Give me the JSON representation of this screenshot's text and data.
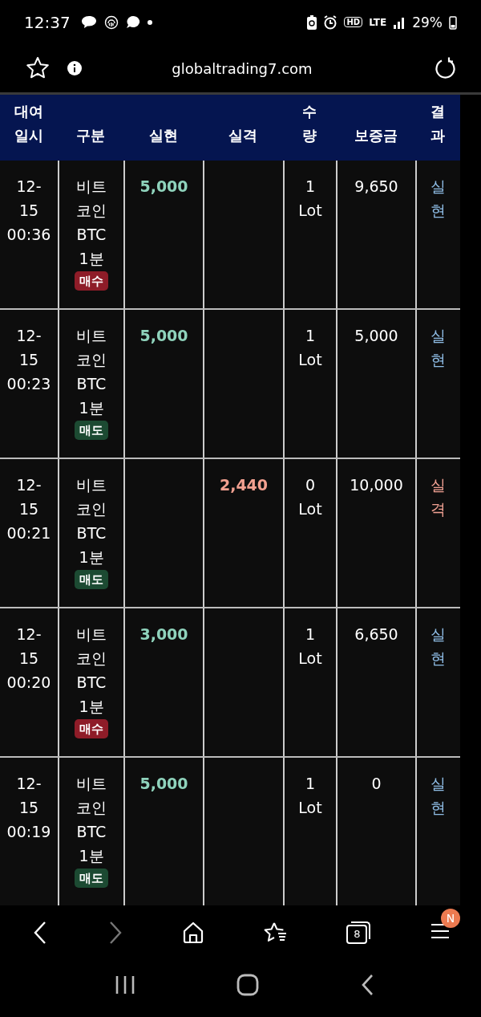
{
  "status_bar": {
    "time": "12:37",
    "hd": "HD",
    "network": "LTE",
    "battery": "29%"
  },
  "address_bar": {
    "url": "globaltrading7.com"
  },
  "table": {
    "columns": [
      "대여일시",
      "구분",
      "실현",
      "실격",
      "수량",
      "보증금",
      "결과"
    ],
    "rows": [
      {
        "date": "12-15 00:36",
        "category": "비트코인 BTC 1분",
        "side": {
          "label": "매수",
          "kind": "buy"
        },
        "realized": "5,000",
        "failed": "",
        "quantity": "1 Lot",
        "deposit": "9,650",
        "result": {
          "text": "실현",
          "kind": "realized"
        }
      },
      {
        "date": "12-15 00:23",
        "category": "비트코인 BTC 1분",
        "side": {
          "label": "매도",
          "kind": "sell"
        },
        "realized": "5,000",
        "failed": "",
        "quantity": "1 Lot",
        "deposit": "5,000",
        "result": {
          "text": "실현",
          "kind": "realized"
        }
      },
      {
        "date": "12-15 00:21",
        "category": "비트코인 BTC 1분",
        "side": {
          "label": "매도",
          "kind": "sell"
        },
        "realized": "",
        "failed": "2,440",
        "quantity": "0 Lot",
        "deposit": "10,000",
        "result": {
          "text": "실격",
          "kind": "failed"
        }
      },
      {
        "date": "12-15 00:20",
        "category": "비트코인 BTC 1분",
        "side": {
          "label": "매수",
          "kind": "buy"
        },
        "realized": "3,000",
        "failed": "",
        "quantity": "1 Lot",
        "deposit": "6,650",
        "result": {
          "text": "실현",
          "kind": "realized"
        }
      },
      {
        "date": "12-15 00:19",
        "category": "비트코인 BTC 1분",
        "side": {
          "label": "매도",
          "kind": "sell"
        },
        "realized": "5,000",
        "failed": "",
        "quantity": "1 Lot",
        "deposit": "0",
        "result": {
          "text": "실현",
          "kind": "realized"
        }
      }
    ]
  },
  "bottom_toolbar": {
    "forward_disabled": true,
    "tab_count": "8",
    "menu_badge": "N"
  }
}
